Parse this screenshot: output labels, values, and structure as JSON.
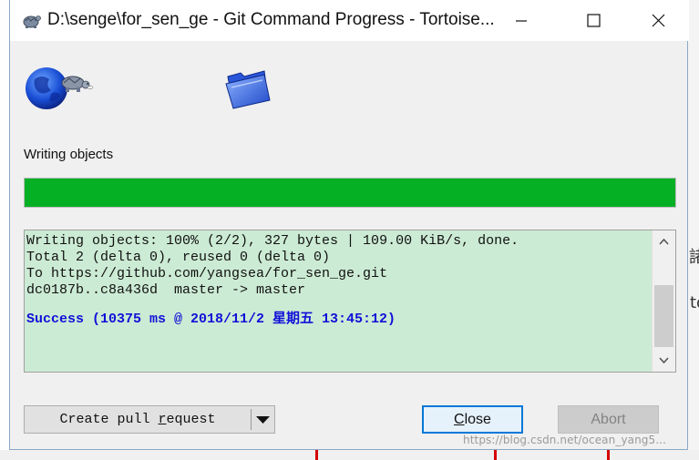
{
  "window": {
    "title": "D:\\senge\\for_sen_ge - Git Command Progress - Tortoise...",
    "minimize_label": "Minimize",
    "maximize_label": "Maximize",
    "close_label": "Close window"
  },
  "status": {
    "label": "Writing objects",
    "progress_percent": 100
  },
  "log": {
    "lines": [
      "Writing objects: 100% (2/2), 327 bytes | 109.00 KiB/s, done.",
      "Total 2 (delta 0), reused 0 (delta 0)",
      "To https://github.com/yangsea/for_sen_ge.git",
      "dc0187b..c8a436d  master -> master"
    ],
    "success": "Success (10375 ms @ 2018/11/2 星期五 13:45:12)"
  },
  "buttons": {
    "pull_request_pre": "Create pull ",
    "pull_request_mnemonic": "r",
    "pull_request_post": "equest",
    "close_mnemonic": "C",
    "close_rest": "lose",
    "abort": "Abort"
  },
  "background": {
    "char1": "諸",
    "char2": "to",
    "watermark": "https://blog.csdn.net/ocean_yang5..."
  },
  "colors": {
    "progress_fill": "#06b025",
    "log_background": "#ccebd4",
    "success_text": "#1010d8",
    "default_button_border": "#0078d7"
  }
}
